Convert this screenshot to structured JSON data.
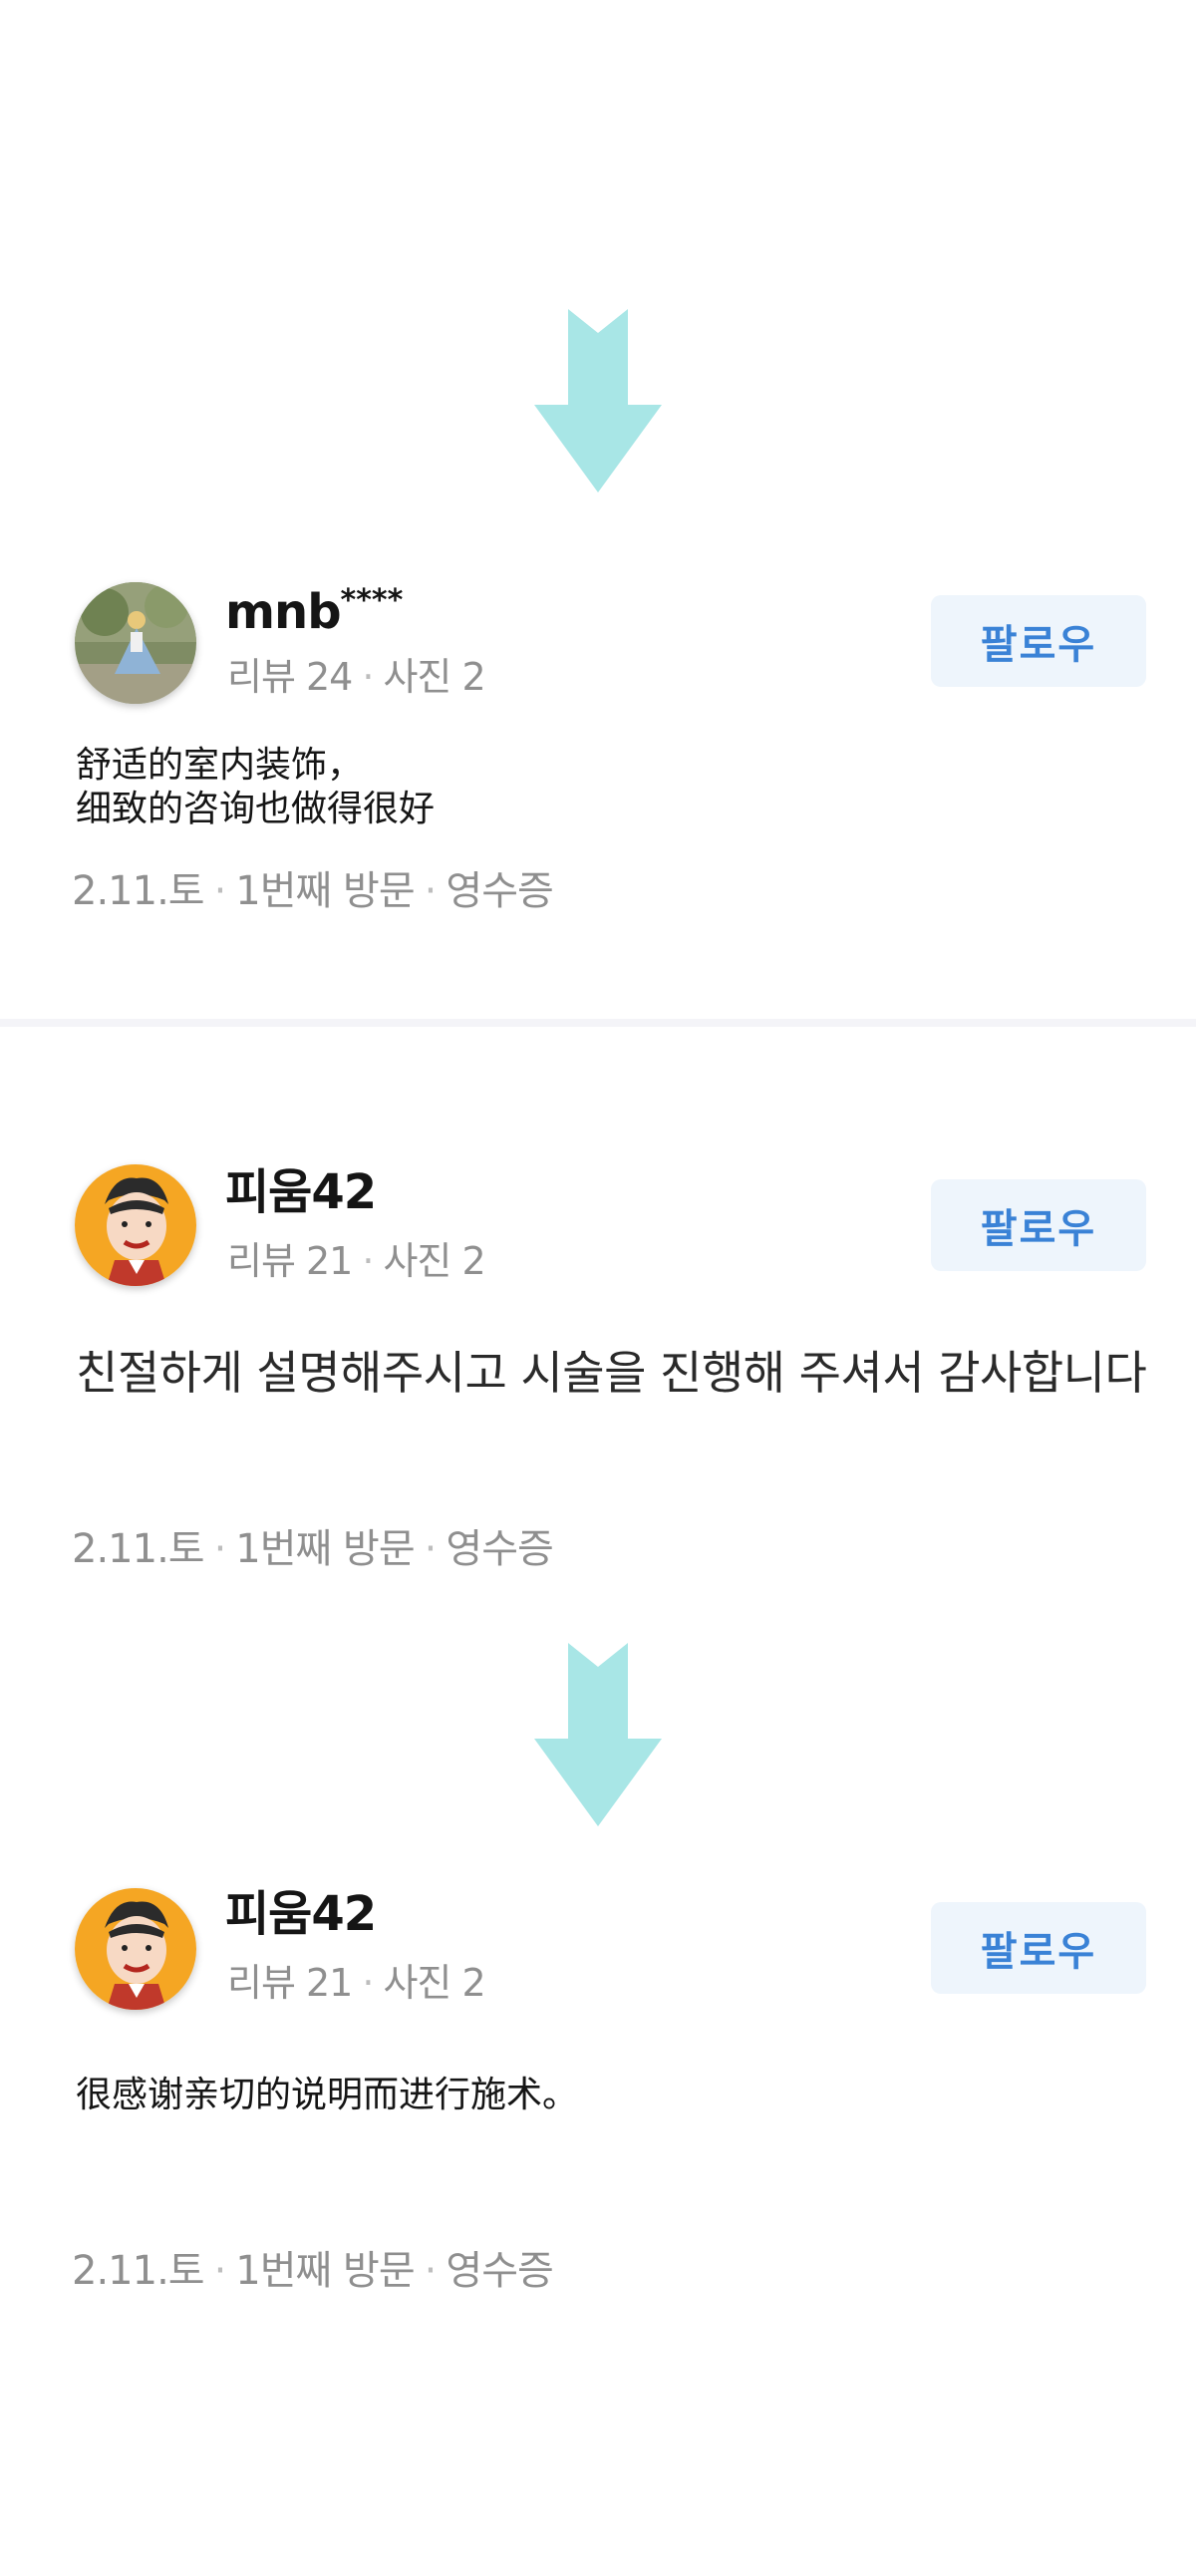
{
  "colors": {
    "arrow": "#a8e6e6",
    "follow_text": "#3a82d6",
    "follow_bg": "#eef5fc",
    "meta_text": "#8f8f8f"
  },
  "reviews": [
    {
      "avatar_icon": "alice-photo-avatar",
      "username": "mnb",
      "username_mask": "****",
      "review_count": "리뷰 24",
      "photo_count": "사진 2",
      "follow_label": "팔로우",
      "body_line1": "舒适的室内装饰，",
      "body_line2": "细致的咨询也做得很好",
      "date": "2.11.토",
      "visit": "1번째 방문",
      "receipt": "영수증"
    },
    {
      "avatar_icon": "cartoon-man-avatar",
      "username": "피움42",
      "review_count": "리뷰 21",
      "photo_count": "사진 2",
      "follow_label": "팔로우",
      "body": "친절하게 설명해주시고 시술을 진행해 주셔서 감사합니다",
      "date": "2.11.토",
      "visit": "1번째 방문",
      "receipt": "영수증"
    },
    {
      "avatar_icon": "cartoon-man-avatar",
      "username": "피움42",
      "review_count": "리뷰 21",
      "photo_count": "사진 2",
      "follow_label": "팔로우",
      "body": "很感谢亲切的说明而进行施术。",
      "date": "2.11.토",
      "visit": "1번째 방문",
      "receipt": "영수증"
    }
  ]
}
